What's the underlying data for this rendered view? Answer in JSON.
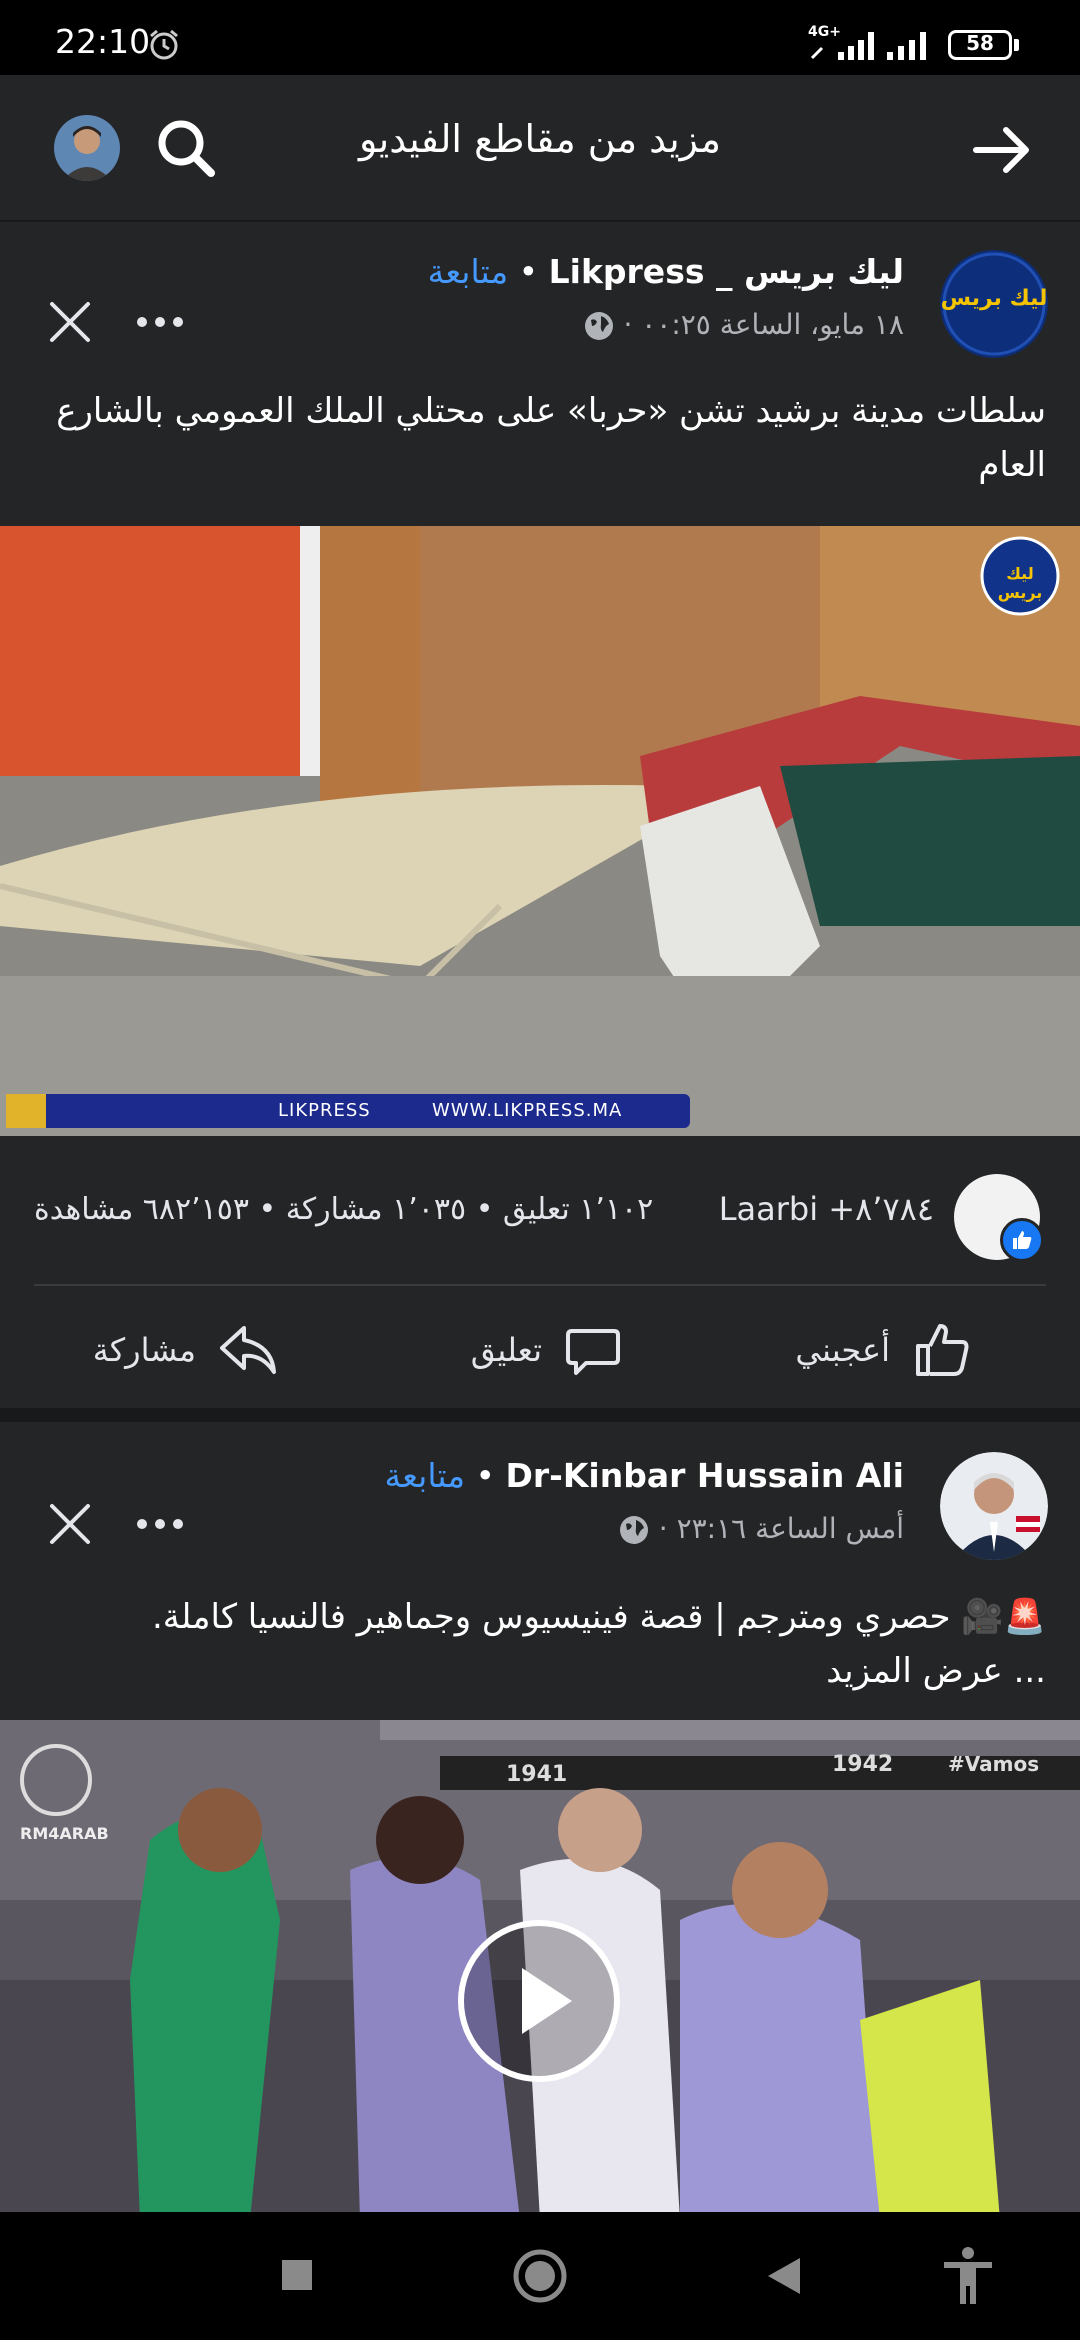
{
  "status_bar": {
    "time": "22:10",
    "network": "4G+",
    "battery": "58"
  },
  "header": {
    "title": "مزيد من مقاطع الفيديو"
  },
  "posts": [
    {
      "page_name": "ليك بريس _ Likpress",
      "follow_label": "متابعة",
      "meta": "١٨ مايو، الساعة ٠٠:٢٥ ·",
      "text": "سلطات مدينة برشيد تشن «حربا» على محتلي الملك العمومي بالشارع العام",
      "logo_text": "ليك بريس",
      "watermark_url": "WWW.LIKPRESS.MA",
      "watermark_brand": "LIKPRESS",
      "reactions": "Laarbi +٨٬٧٨٤",
      "stats": "١٬١٠٢ تعليق • ١٬٠٣٥ مشاركة • ٦٨٢٬١٥٣ مشاهدة",
      "actions": {
        "like": "أعجبني",
        "comment": "تعليق",
        "share": "مشاركة"
      }
    },
    {
      "page_name": "Dr-Kinbar Hussain Ali",
      "follow_label": "متابعة",
      "meta": "أمس الساعة ٢٣:١٦ ·",
      "text": "🚨🎥 حصري ومترجم | قصة فينيسيوس وجماهير فالنسيا كاملة.",
      "see_more": "... عرض المزيد",
      "watermark": "RM4ARAB",
      "stand_year_1": "1941",
      "stand_year_2": "1942",
      "stand_text": "#Vamos"
    }
  ],
  "colors": {
    "background": "#18191a",
    "card": "#242526",
    "accent": "#4599ff",
    "like_blue": "#1877f2"
  }
}
